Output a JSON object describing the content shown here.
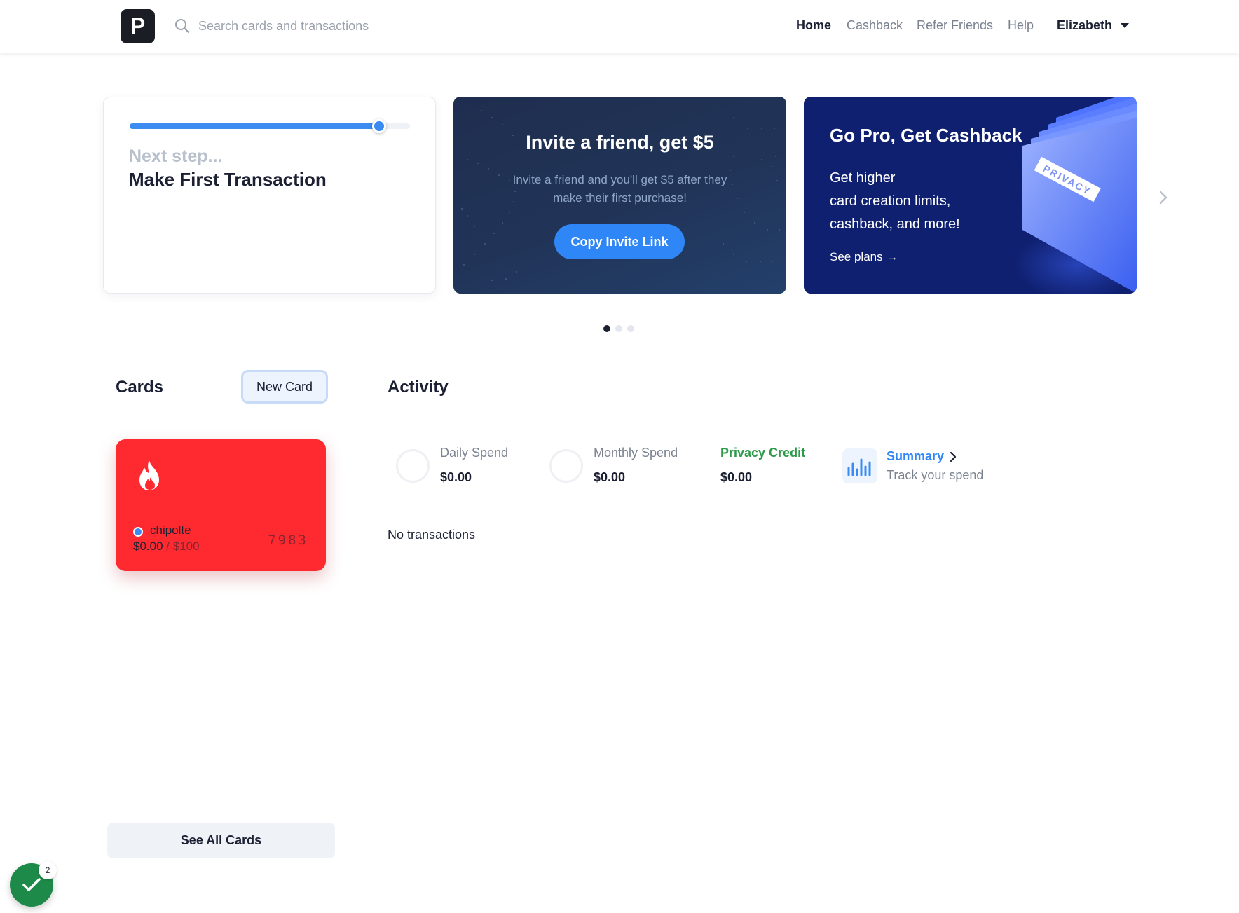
{
  "header": {
    "logo_letter": "P",
    "search_placeholder": "Search cards and transactions",
    "nav": [
      {
        "label": "Home",
        "active": true
      },
      {
        "label": "Cashback",
        "active": false
      },
      {
        "label": "Refer Friends",
        "active": false
      },
      {
        "label": "Help",
        "active": false
      }
    ],
    "user_name": "Elizabeth"
  },
  "promos": {
    "progress": {
      "eyebrow": "Next step...",
      "title": "Make First Transaction",
      "progress_fraction": 0.89
    },
    "invite": {
      "title": "Invite a friend, get $5",
      "body": "Invite a friend and you'll get $5 after they make their first purchase!",
      "button": "Copy Invite Link"
    },
    "pro": {
      "title": "Go Pro, Get Cashback",
      "body_lines": [
        "Get higher",
        "card creation limits,",
        "cashback, and more!"
      ],
      "link": "See plans →",
      "art_label": "PRIVACY"
    },
    "carousel": {
      "total_pages": 3,
      "active_page": 1
    }
  },
  "cards": {
    "title": "Cards",
    "new_card_button": "New Card",
    "items": [
      {
        "name": "chipolte",
        "spent": "$0.00",
        "limit": "/ $100",
        "last4": "7983",
        "color": "#fe2a30",
        "icon": "flame-icon"
      }
    ],
    "see_all_button": "See All Cards"
  },
  "activity": {
    "title": "Activity",
    "stats": [
      {
        "label": "Daily Spend",
        "value": "$0.00"
      },
      {
        "label": "Monthly Spend",
        "value": "$0.00"
      },
      {
        "label": "Privacy Credit",
        "value": "$0.00"
      }
    ],
    "summary": {
      "label": "Summary",
      "sub": "Track your spend"
    },
    "empty_text": "No transactions"
  },
  "floating": {
    "badge_count": "2"
  },
  "colors": {
    "accent": "#2f86f6",
    "card_red": "#fe2a30",
    "pro_navy": "#0f2070",
    "credit_green": "#2c9a4a"
  }
}
